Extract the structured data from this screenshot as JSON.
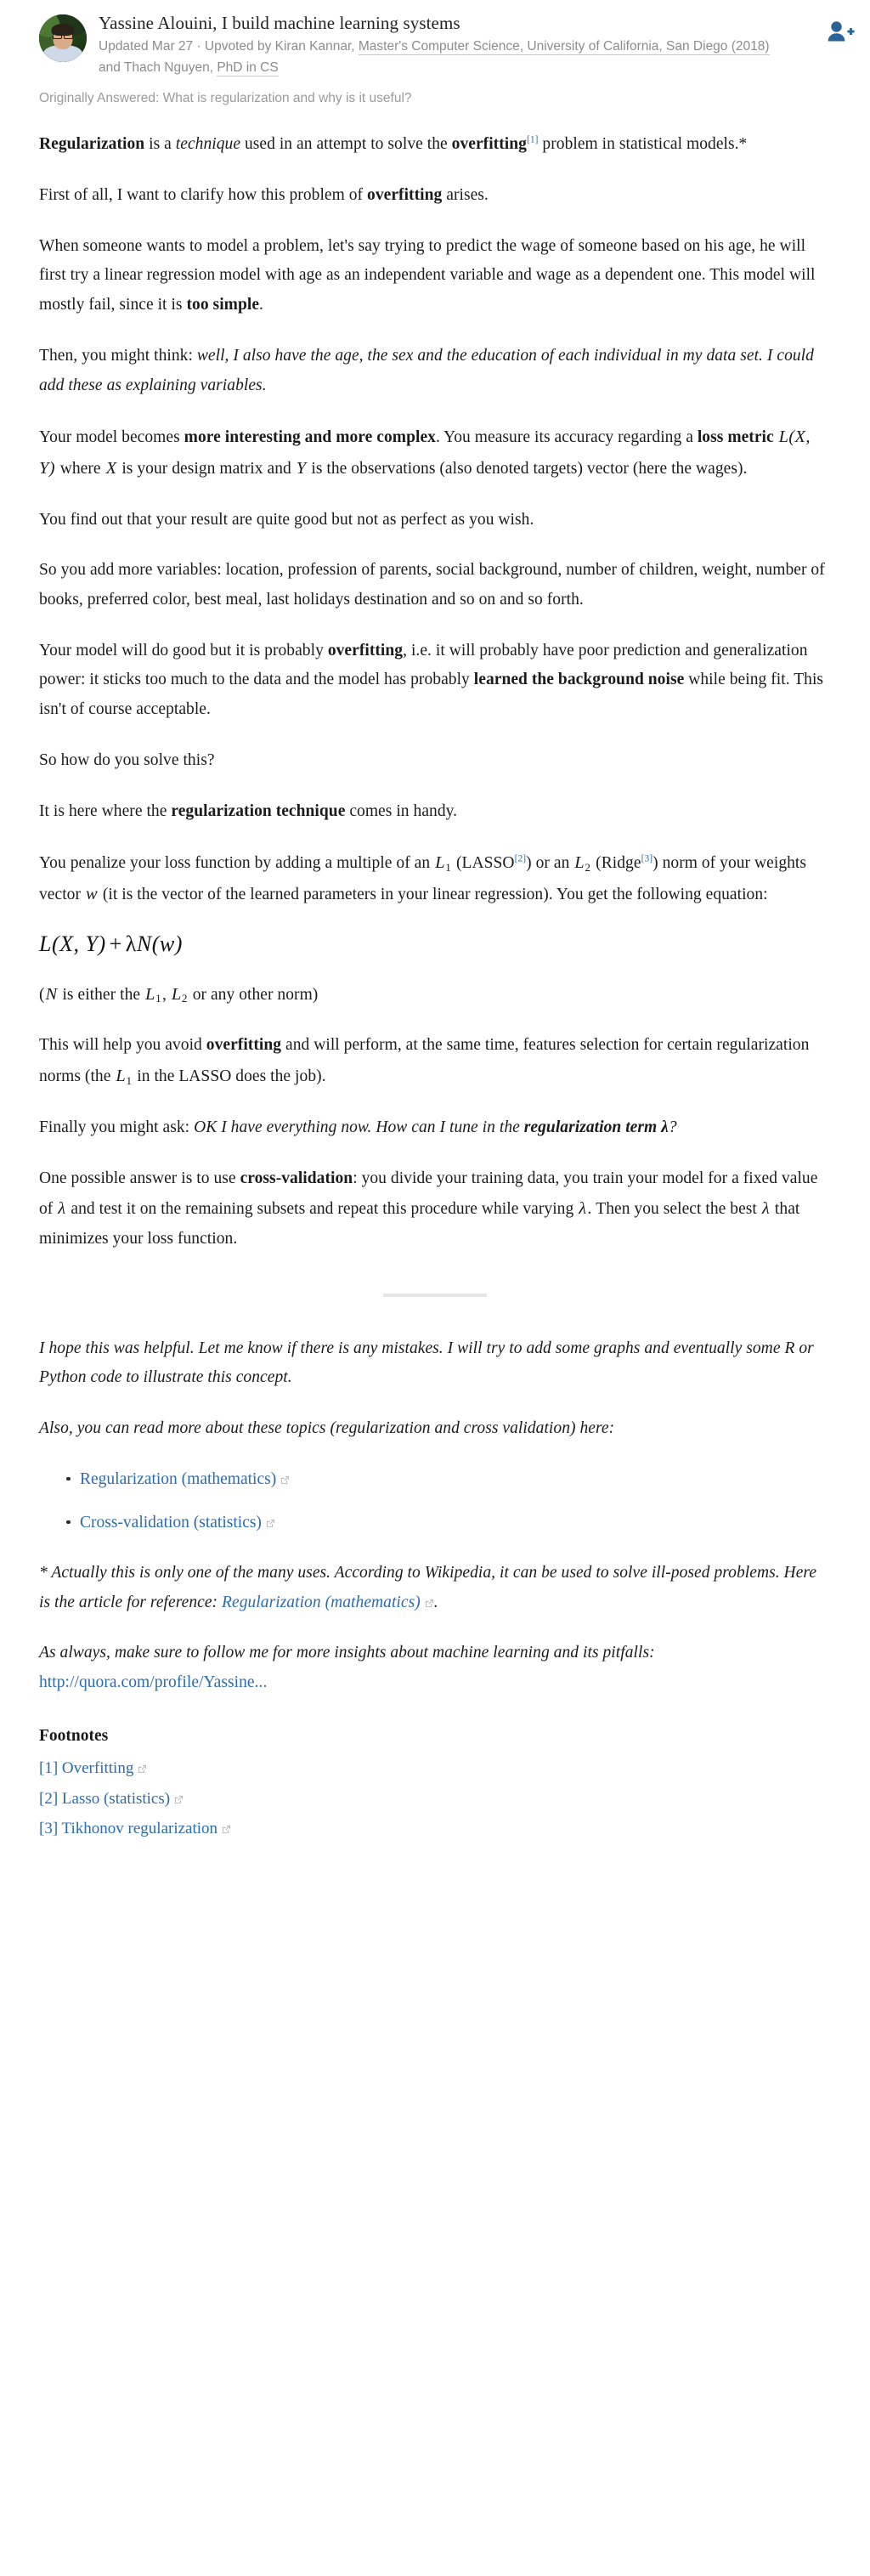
{
  "colors": {
    "link": "#2b6cb0",
    "footnote_ref": "#2f6cb0",
    "byline_gray": "#8c8c8c",
    "divider": "#e6e6e6",
    "follow_icon": "#2a6496",
    "text": "#1b1b1b"
  },
  "header": {
    "avatar_alt": "Yassine Alouini profile photo",
    "author_name": "Yassine Alouini, I build machine learning systems",
    "byline_prefix": "Updated Mar 27 · Upvoted by Kiran Kannar, ",
    "byline_credential_1": "Master's Computer Science, University of California, San Diego (2018)",
    "byline_middle": " and Thach Nguyen, ",
    "byline_credential_2": "PhD in CS",
    "originally_answered": "Originally Answered: What is regularization and why is it useful?",
    "follow_button_label": "follow-user"
  },
  "body": {
    "p1": {
      "b1": "Regularization",
      "t1": " is a ",
      "i1": "technique",
      "t2": " used in an attempt to solve the ",
      "b2": "overfitting",
      "fn": "[1]",
      "t3": " problem in statistical models.*"
    },
    "p2": {
      "t1": "First of all, I want to clarify how this problem of ",
      "b1": "overfitting",
      "t2": " arises."
    },
    "p3": {
      "t1": "When someone wants to model a problem, let's say trying to predict the wage of someone based on his age, he will first try a linear regression model with age as an independent variable and wage as a dependent one. This model will mostly fail, since it is ",
      "b1": "too simple",
      "t2": "."
    },
    "p4": {
      "t1": "Then, you might think: ",
      "i1": "well, I also have the age, the sex and the education of each individual in my data set. I could add these as explaining variables."
    },
    "p5": {
      "t1": "Your model becomes ",
      "b1": "more interesting and more complex",
      "t2": ". You measure its accuracy regarding a ",
      "b2": "loss metric",
      "m1": "L(X, Y)",
      "t3": " where ",
      "m2": "X",
      "t4": " is your design matrix and ",
      "m3": "Y",
      "t5": " is the observations (also denoted targets) vector (here the wages)."
    },
    "p6": {
      "t1": "You find out that your result are quite good but not as perfect as you wish."
    },
    "p7": {
      "t1": "So you add more variables: location, profession of parents, social background, number of children, weight, number of books, preferred color, best meal, last holidays destination and so on and so forth."
    },
    "p8": {
      "t1": "Your model will do good but it is probably ",
      "b1": "overfitting",
      "t2": ", i.e. it will probably have poor prediction and generalization power: it sticks too much to the data and the model has probably ",
      "b2": "learned the background noise",
      "t3": " while being fit. This isn't of course acceptable."
    },
    "p9": {
      "t1": "So how do you solve this?"
    },
    "p10": {
      "t1": "It is here where the ",
      "b1": "regularization technique",
      "t2": " comes in handy."
    },
    "p11": {
      "t1": "You penalize your loss function by adding a multiple of an ",
      "m1": "L",
      "m1sub": "1",
      "t2": " (LASSO",
      "fn2": "[2]",
      "t3": ") or an ",
      "m2": "L",
      "m2sub": "2",
      "t4": " (Ridge",
      "fn3": "[3]",
      "t5": ") norm of your weights vector ",
      "m3": "w",
      "t6": " (it is the vector of the learned parameters in your linear regression). You get the following equation:"
    },
    "equation": {
      "lhs": "L(X, Y)",
      "op": "+",
      "rhs_lambda": "λ",
      "rhs": "N(w)"
    },
    "p12": {
      "t1": "(",
      "m1": "N",
      "t2": " is either the ",
      "m2": "L",
      "m2sub": "1",
      "t3": ", ",
      "m3": "L",
      "m3sub": "2",
      "t4": " or any other norm)"
    },
    "p13": {
      "t1": "This will help you avoid ",
      "b1": "overfitting",
      "t2": " and will perform, at the same time, features selection for certain regularization norms (the ",
      "m1": "L",
      "m1sub": "1",
      "t3": " in the LASSO does the job)."
    },
    "p14": {
      "t1": "Finally you might ask: ",
      "i1": "OK I have everything now. How can I tune in the ",
      "bi1": "regularization term",
      "lam": " λ",
      "i2": "?"
    },
    "p15": {
      "t1": "One possible answer is to use ",
      "b1": "cross-validation",
      "t2": ": you divide your training data, you train your model for a fixed value of ",
      "lam1": "λ",
      "t3": " and test it on the remaining subsets and repeat this procedure while varying ",
      "lam2": "λ",
      "t4": ". Then you select the best ",
      "lam3": "λ",
      "t5": " that minimizes your loss function."
    },
    "p16": {
      "i1": "I hope this was helpful. Let me know if there is any mistakes. I will try to add some graphs and eventually some R or Python code to illustrate this concept."
    },
    "p17": {
      "i1": "Also, you can read more about these topics (regularization and cross validation) here:"
    },
    "links": [
      {
        "label": "Regularization (mathematics)",
        "icon": "external-link-icon"
      },
      {
        "label": "Cross-validation (statistics)",
        "icon": "external-link-icon"
      }
    ],
    "p18": {
      "i1": "* Actually this is only one of the many uses. According to Wikipedia, it can be used to solve ill-posed problems. Here is the article for reference: ",
      "link": "Regularization (mathematics)",
      "i2": "."
    },
    "p19": {
      "i1": "As always, make sure to follow me for more insights about machine learning and its pitfalls: ",
      "link": "http://quora.com/profile/Yassine..."
    }
  },
  "footnotes": {
    "title": "Footnotes",
    "items": [
      {
        "label": "[1] Overfitting",
        "icon": "external-link-icon"
      },
      {
        "label": "[2] Lasso (statistics)",
        "icon": "external-link-icon"
      },
      {
        "label": "[3] Tikhonov regularization",
        "icon": "external-link-icon"
      }
    ]
  }
}
